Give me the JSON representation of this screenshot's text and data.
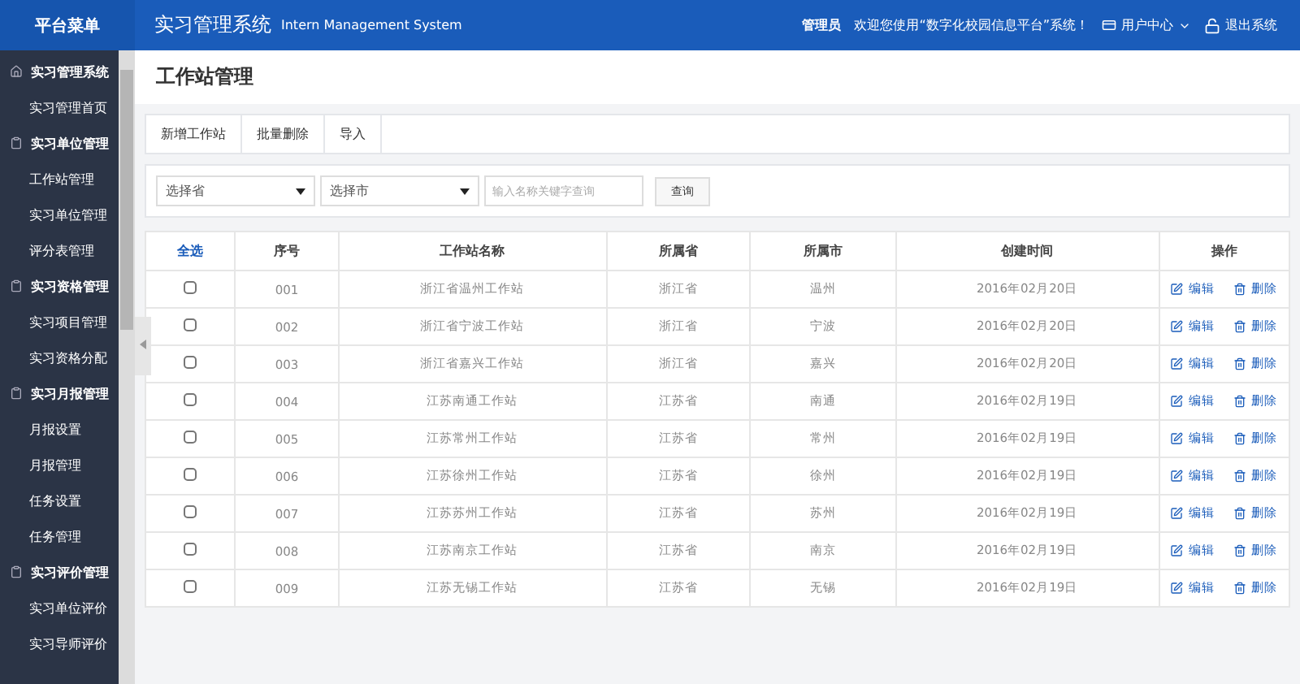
{
  "sidebar": {
    "title": "平台菜单",
    "groups": [
      {
        "label": "实习管理系统",
        "kind": "home",
        "children": [
          {
            "label": "实习管理首页"
          }
        ]
      },
      {
        "label": "实习单位管理",
        "kind": "section",
        "children": [
          {
            "label": "工作站管理"
          },
          {
            "label": "实习单位管理"
          },
          {
            "label": "评分表管理"
          }
        ]
      },
      {
        "label": "实习资格管理",
        "kind": "section",
        "children": [
          {
            "label": "实习项目管理"
          },
          {
            "label": "实习资格分配"
          }
        ]
      },
      {
        "label": "实习月报管理",
        "kind": "section",
        "children": [
          {
            "label": "月报设置"
          },
          {
            "label": "月报管理"
          },
          {
            "label": "任务设置"
          },
          {
            "label": "任务管理"
          }
        ]
      },
      {
        "label": "实习评价管理",
        "kind": "section",
        "children": [
          {
            "label": "实习单位评价"
          },
          {
            "label": "实习导师评价"
          }
        ]
      }
    ]
  },
  "header": {
    "title": "实习管理系统",
    "subtitle": "Intern Management System",
    "role": "管理员",
    "welcome": "欢迎您使用“数字化校园信息平台”系统！",
    "user_menu": "用户中心",
    "logout": "退出系统"
  },
  "page_title": "工作站管理",
  "toolbar": [
    "新增工作站",
    "批量删除",
    "导入"
  ],
  "filters": {
    "province": {
      "placeholder": "选择省"
    },
    "city": {
      "placeholder": "选择市"
    },
    "search": {
      "placeholder": "输入名称关键字查询"
    },
    "button": "查询"
  },
  "table": {
    "select_all": "全选",
    "columns": [
      "序号",
      "工作站名称",
      "所属省",
      "所属市",
      "创建时间",
      "操作"
    ],
    "rows": [
      {
        "checked": false,
        "cells": [
          "001",
          "浙江省温州工作站",
          "浙江省",
          "温州",
          "2016年02月20日"
        ],
        "actions": [
          "编辑",
          "删除"
        ]
      },
      {
        "checked": false,
        "cells": [
          "002",
          "浙江省宁波工作站",
          "浙江省",
          "宁波",
          "2016年02月20日"
        ],
        "actions": [
          "编辑",
          "删除"
        ]
      },
      {
        "checked": false,
        "cells": [
          "003",
          "浙江省嘉兴工作站",
          "浙江省",
          "嘉兴",
          "2016年02月20日"
        ],
        "actions": [
          "编辑",
          "删除"
        ]
      },
      {
        "checked": false,
        "cells": [
          "004",
          "江苏南通工作站",
          "江苏省",
          "南通",
          "2016年02月19日"
        ],
        "actions": [
          "编辑",
          "删除"
        ]
      },
      {
        "checked": false,
        "cells": [
          "005",
          "江苏常州工作站",
          "江苏省",
          "常州",
          "2016年02月19日"
        ],
        "actions": [
          "编辑",
          "删除"
        ]
      },
      {
        "checked": false,
        "cells": [
          "006",
          "江苏徐州工作站",
          "江苏省",
          "徐州",
          "2016年02月19日"
        ],
        "actions": [
          "编辑",
          "删除"
        ]
      },
      {
        "checked": false,
        "cells": [
          "007",
          "江苏苏州工作站",
          "江苏省",
          "苏州",
          "2016年02月19日"
        ],
        "actions": [
          "编辑",
          "删除"
        ]
      },
      {
        "checked": false,
        "cells": [
          "008",
          "江苏南京工作站",
          "江苏省",
          "南京",
          "2016年02月19日"
        ],
        "actions": [
          "编辑",
          "删除"
        ]
      },
      {
        "checked": false,
        "cells": [
          "009",
          "江苏无锡工作站",
          "江苏省",
          "无锡",
          "2016年02月19日"
        ],
        "actions": [
          "编辑",
          "删除"
        ]
      }
    ]
  }
}
